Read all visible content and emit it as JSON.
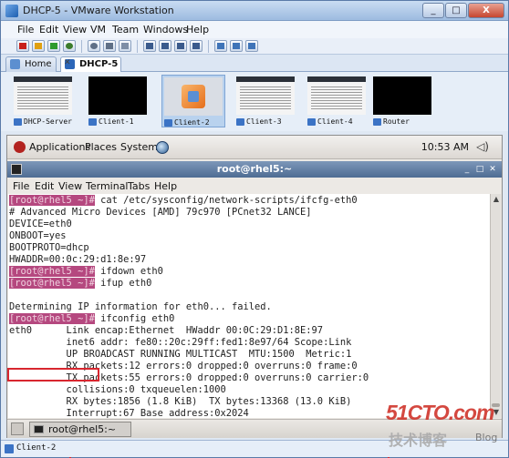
{
  "window": {
    "title": "DHCP-5 - VMware Workstation",
    "min": "_",
    "max": "□",
    "close": "X"
  },
  "menu": [
    "File",
    "Edit",
    "View",
    "VM",
    "Team",
    "Windows",
    "Help"
  ],
  "tabs": {
    "home": "Home",
    "active": "DHCP-5"
  },
  "thumbnails": [
    "DHCP-Server",
    "Client-1",
    "Client-2",
    "Client-3",
    "Client-4",
    "Router"
  ],
  "guest_panel": {
    "applications": "Applications",
    "places": "Places",
    "system": "System",
    "clock": "10:53 AM",
    "volume": "◁)"
  },
  "terminal": {
    "title": "root@rhel5:~",
    "menu": [
      "File",
      "Edit",
      "View",
      "Terminal",
      "Tabs",
      "Help"
    ],
    "prompt": "[root@rhel5 ~]#",
    "lines": [
      {
        "prompt": true,
        "text": " cat /etc/sysconfig/network-scripts/ifcfg-eth0"
      },
      {
        "prompt": false,
        "text": "# Advanced Micro Devices [AMD] 79c970 [PCnet32 LANCE]"
      },
      {
        "prompt": false,
        "text": "DEVICE=eth0"
      },
      {
        "prompt": false,
        "text": "ONBOOT=yes"
      },
      {
        "prompt": false,
        "text": "BOOTPROTO=dhcp"
      },
      {
        "prompt": false,
        "text": "HWADDR=00:0c:29:d1:8e:97"
      },
      {
        "prompt": true,
        "text": " ifdown eth0"
      },
      {
        "prompt": true,
        "text": " ifup eth0"
      },
      {
        "prompt": false,
        "text": ""
      },
      {
        "prompt": false,
        "text": "Determining IP information for eth0... failed."
      },
      {
        "prompt": true,
        "text": " ifconfig eth0"
      },
      {
        "prompt": false,
        "text": "eth0      Link encap:Ethernet  HWaddr 00:0C:29:D1:8E:97"
      },
      {
        "prompt": false,
        "text": "          inet6 addr: fe80::20c:29ff:fed1:8e97/64 Scope:Link"
      },
      {
        "prompt": false,
        "text": "          UP BROADCAST RUNNING MULTICAST  MTU:1500  Metric:1"
      },
      {
        "prompt": false,
        "text": "          RX packets:12 errors:0 dropped:0 overruns:0 frame:0"
      },
      {
        "prompt": false,
        "text": "          TX packets:55 errors:0 dropped:0 overruns:0 carrier:0"
      },
      {
        "prompt": false,
        "text": "          collisions:0 txqueuelen:1000"
      },
      {
        "prompt": false,
        "text": "          RX bytes:1856 (1.8 KiB)  TX bytes:13368 (13.0 KiB)"
      },
      {
        "prompt": false,
        "text": "          Interrupt:67 Base address:0x2024"
      }
    ]
  },
  "taskbar": {
    "task": "root@rhel5:~"
  },
  "status": "Client-2",
  "watermark": {
    "big": "51CTO.com",
    "small": "技术博客",
    "blog": "Blog"
  }
}
